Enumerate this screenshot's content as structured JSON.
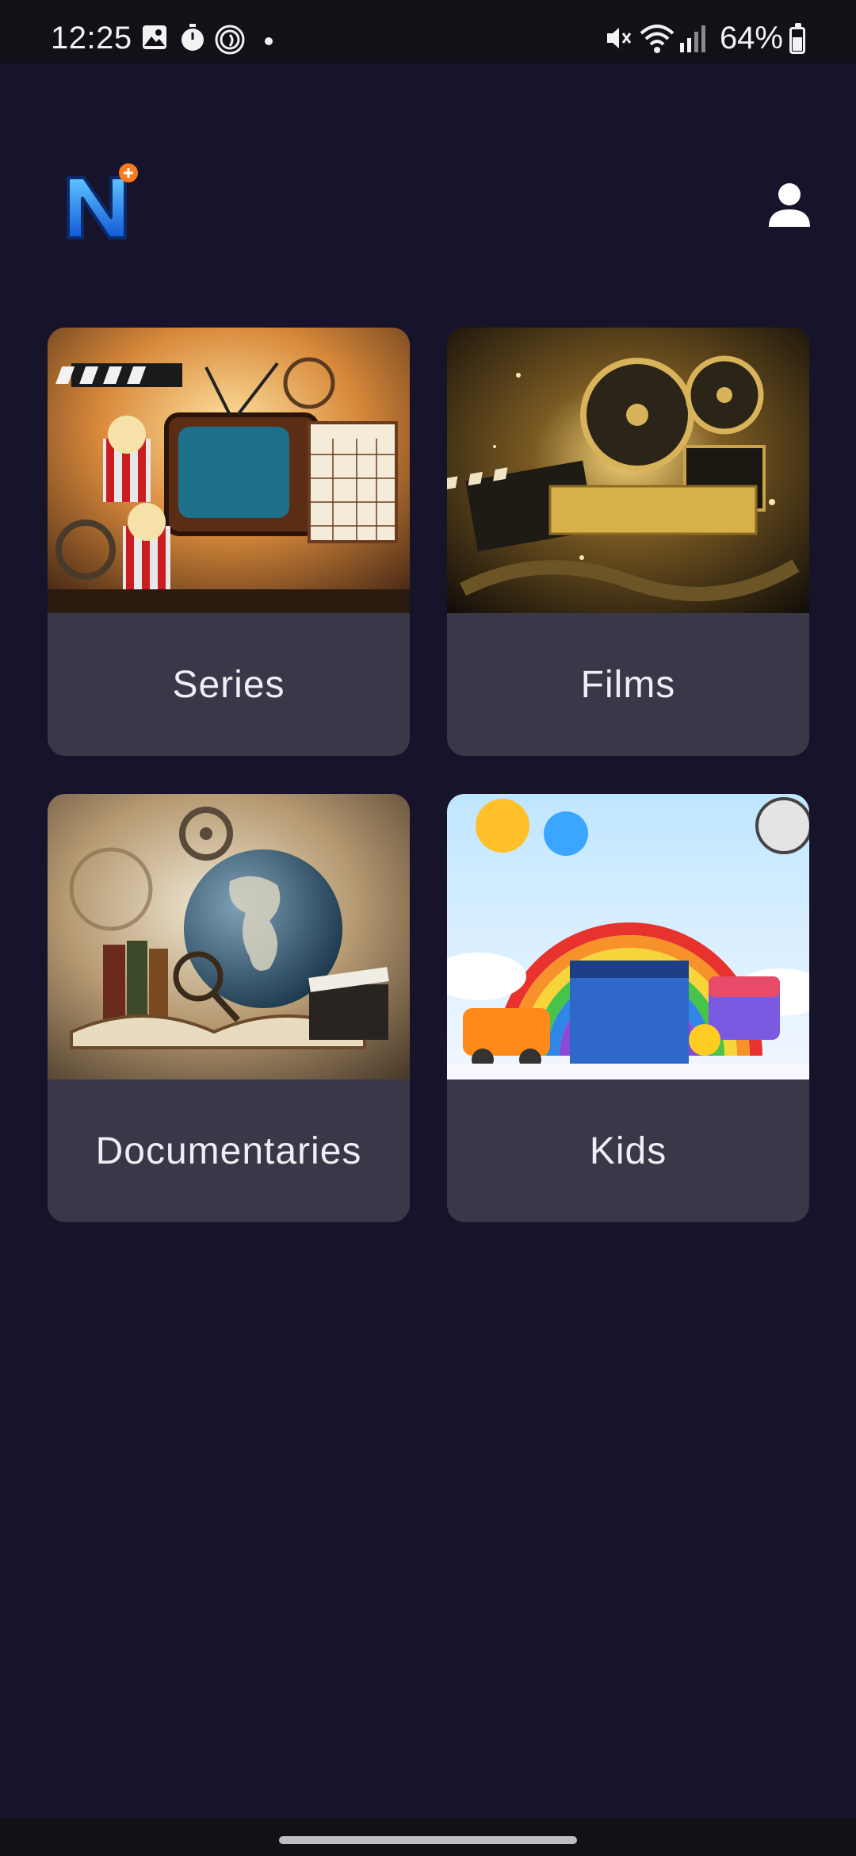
{
  "status_bar": {
    "time": "12:25",
    "battery_percent": "64%",
    "icons": [
      "image-icon",
      "timer-icon",
      "fingerprint-icon",
      "dot-icon",
      "mute-icon",
      "wifi-icon",
      "signal-icon",
      "battery-icon"
    ]
  },
  "header": {
    "logo_icon": "n-plus-logo-icon",
    "profile_icon": "user-profile-icon"
  },
  "categories": [
    {
      "label": "Series"
    },
    {
      "label": "Films"
    },
    {
      "label": "Documentaries"
    },
    {
      "label": "Kids"
    }
  ],
  "colors": {
    "background": "#16132a",
    "card": "#393849",
    "accent_orange": "#ff7a1a",
    "logo_blue": "#1e8bff"
  }
}
